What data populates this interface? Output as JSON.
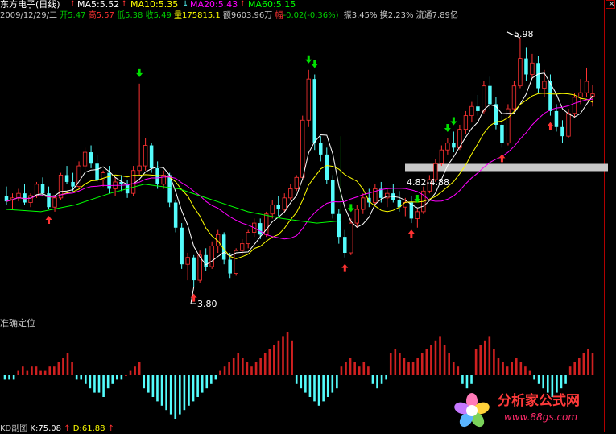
{
  "header": {
    "title": "东方电子(日线)",
    "ma5": "MA5:5.52",
    "ma10": "MA10:5.35",
    "ma20": "MA20:5.43",
    "ma60": "MA60:5.15"
  },
  "info": {
    "date": "2009/12/29/二",
    "open_label": "开",
    "open": "5.47",
    "high_label": "高",
    "high": "5.57",
    "low_label": "低",
    "low": "5.38",
    "close_label": "收",
    "close": "5.49",
    "vol_label": "量",
    "vol": "175815.1",
    "amt_label": "额",
    "amt": "9603.96万",
    "chg_label": "幅",
    "chg": "-0.02(-0.36%)",
    "amp_label": "振",
    "amp": "3.45%",
    "turn_label": "换",
    "turn": "2.23%",
    "float_label": "流通",
    "float": "7.89亿"
  },
  "annotations": {
    "high_mark": "5.98",
    "low_mark": "3.80",
    "zone_label": "4.82-4.88"
  },
  "sub_panel": {
    "title": "准确定位",
    "footer": "KD副图",
    "k": "K:75.08",
    "d": "D:61.88"
  },
  "watermark": {
    "name": "分析家公式网",
    "url": "www.88gs.com"
  },
  "colors": {
    "up": "#ff3232",
    "down": "#54fcfc",
    "ma5": "#ffffff",
    "ma10": "#ffff00",
    "ma20": "#ff00ff",
    "ma60": "#00ff00",
    "osc_pos": "#d02020",
    "osc_neg": "#54fcfc",
    "zone": "#c8c8c8",
    "buy_arrow": "#ff3232",
    "sell_arrow": "#00e000"
  },
  "chart_data": {
    "type": "candlestick",
    "title": "东方电子(日线)",
    "last_date": "2009/12/29",
    "price_range": [
      3.6,
      6.1
    ],
    "candles": [
      [
        4.6,
        4.68,
        4.52,
        4.55
      ],
      [
        4.56,
        4.62,
        4.48,
        4.58
      ],
      [
        4.58,
        4.66,
        4.55,
        4.62
      ],
      [
        4.62,
        4.7,
        4.52,
        4.54
      ],
      [
        4.54,
        4.62,
        4.5,
        4.6
      ],
      [
        4.6,
        4.72,
        4.58,
        4.7
      ],
      [
        4.7,
        4.76,
        4.6,
        4.62
      ],
      [
        4.62,
        4.68,
        4.48,
        4.5
      ],
      [
        4.5,
        4.6,
        4.46,
        4.58
      ],
      [
        4.58,
        4.8,
        4.56,
        4.78
      ],
      [
        4.78,
        4.86,
        4.7,
        4.72
      ],
      [
        4.72,
        4.8,
        4.64,
        4.68
      ],
      [
        4.68,
        4.9,
        4.66,
        4.86
      ],
      [
        4.86,
        5.02,
        4.82,
        4.98
      ],
      [
        4.98,
        5.04,
        4.84,
        4.88
      ],
      [
        4.88,
        4.96,
        4.72,
        4.74
      ],
      [
        4.74,
        4.82,
        4.68,
        4.8
      ],
      [
        4.8,
        4.86,
        4.62,
        4.66
      ],
      [
        4.66,
        4.76,
        4.6,
        4.72
      ],
      [
        4.72,
        4.78,
        4.64,
        4.7
      ],
      [
        4.7,
        4.74,
        4.58,
        4.62
      ],
      [
        4.62,
        4.86,
        4.6,
        4.82
      ],
      [
        4.82,
        5.58,
        4.78,
        4.86
      ],
      [
        4.86,
        5.1,
        4.82,
        5.04
      ],
      [
        5.04,
        5.06,
        4.8,
        4.84
      ],
      [
        4.84,
        4.9,
        4.66,
        4.7
      ],
      [
        4.7,
        4.82,
        4.66,
        4.78
      ],
      [
        4.78,
        4.8,
        4.5,
        4.54
      ],
      [
        4.54,
        4.56,
        4.28,
        4.32
      ],
      [
        4.32,
        4.36,
        3.96,
        4.0
      ],
      [
        4.0,
        4.1,
        3.86,
        4.06
      ],
      [
        4.06,
        4.08,
        3.8,
        3.86
      ],
      [
        3.86,
        4.12,
        3.84,
        4.08
      ],
      [
        4.08,
        4.14,
        3.94,
        3.98
      ],
      [
        3.98,
        4.2,
        3.96,
        4.16
      ],
      [
        4.16,
        4.3,
        4.1,
        4.26
      ],
      [
        4.26,
        4.28,
        4.0,
        4.04
      ],
      [
        4.04,
        4.1,
        3.88,
        3.92
      ],
      [
        3.92,
        4.14,
        3.9,
        4.12
      ],
      [
        4.12,
        4.22,
        4.08,
        4.18
      ],
      [
        4.18,
        4.3,
        4.14,
        4.28
      ],
      [
        4.28,
        4.4,
        4.24,
        4.36
      ],
      [
        4.36,
        4.4,
        4.22,
        4.26
      ],
      [
        4.26,
        4.46,
        4.24,
        4.44
      ],
      [
        4.44,
        4.56,
        4.4,
        4.52
      ],
      [
        4.52,
        4.6,
        4.42,
        4.48
      ],
      [
        4.48,
        4.62,
        4.46,
        4.58
      ],
      [
        4.58,
        4.7,
        4.56,
        4.66
      ],
      [
        4.66,
        4.78,
        4.64,
        4.76
      ],
      [
        4.76,
        5.3,
        4.74,
        5.26
      ],
      [
        5.26,
        5.7,
        5.2,
        5.62
      ],
      [
        5.62,
        5.66,
        5.0,
        5.06
      ],
      [
        5.06,
        5.12,
        4.9,
        4.96
      ],
      [
        4.96,
        5.02,
        4.7,
        4.74
      ],
      [
        4.74,
        4.78,
        4.4,
        4.44
      ],
      [
        4.44,
        4.48,
        4.18,
        4.24
      ],
      [
        4.24,
        4.3,
        4.06,
        4.1
      ],
      [
        4.1,
        4.4,
        4.08,
        4.36
      ],
      [
        4.36,
        4.52,
        4.32,
        4.48
      ],
      [
        4.48,
        4.62,
        4.44,
        4.58
      ],
      [
        4.58,
        4.66,
        4.5,
        4.54
      ],
      [
        4.54,
        4.7,
        4.52,
        4.66
      ],
      [
        4.66,
        4.72,
        4.54,
        4.58
      ],
      [
        4.58,
        4.66,
        4.5,
        4.62
      ],
      [
        4.62,
        4.7,
        4.54,
        4.56
      ],
      [
        4.56,
        4.64,
        4.46,
        4.5
      ],
      [
        4.5,
        4.58,
        4.42,
        4.54
      ],
      [
        4.54,
        4.6,
        4.36,
        4.4
      ],
      [
        4.4,
        4.48,
        4.32,
        4.46
      ],
      [
        4.46,
        4.68,
        4.44,
        4.64
      ],
      [
        4.64,
        4.78,
        4.62,
        4.74
      ],
      [
        4.74,
        4.92,
        4.72,
        4.88
      ],
      [
        4.88,
        5.04,
        4.86,
        5.0
      ],
      [
        5.0,
        5.1,
        4.96,
        5.06
      ],
      [
        5.06,
        5.16,
        4.98,
        5.02
      ],
      [
        5.02,
        5.22,
        5.0,
        5.18
      ],
      [
        5.18,
        5.34,
        5.14,
        5.3
      ],
      [
        5.3,
        5.42,
        5.24,
        5.38
      ],
      [
        5.38,
        5.48,
        5.3,
        5.34
      ],
      [
        5.34,
        5.6,
        5.32,
        5.56
      ],
      [
        5.56,
        5.64,
        5.36,
        5.4
      ],
      [
        5.4,
        5.46,
        5.18,
        5.22
      ],
      [
        5.22,
        5.3,
        5.02,
        5.06
      ],
      [
        5.06,
        5.4,
        5.04,
        5.36
      ],
      [
        5.36,
        5.6,
        5.34,
        5.56
      ],
      [
        5.56,
        5.98,
        5.54,
        5.8
      ],
      [
        5.8,
        5.9,
        5.6,
        5.66
      ],
      [
        5.66,
        5.84,
        5.62,
        5.76
      ],
      [
        5.76,
        5.82,
        5.5,
        5.54
      ],
      [
        5.54,
        5.7,
        5.46,
        5.6
      ],
      [
        5.6,
        5.66,
        5.3,
        5.34
      ],
      [
        5.34,
        5.4,
        5.16,
        5.2
      ],
      [
        5.2,
        5.26,
        5.06,
        5.12
      ],
      [
        5.12,
        5.36,
        5.1,
        5.32
      ],
      [
        5.32,
        5.5,
        5.28,
        5.46
      ],
      [
        5.46,
        5.62,
        5.4,
        5.5
      ],
      [
        5.5,
        5.72,
        5.46,
        5.6
      ],
      [
        5.47,
        5.57,
        5.38,
        5.49
      ]
    ],
    "ma60": [
      [
        0,
        4.48
      ],
      [
        10,
        4.46
      ],
      [
        20,
        4.52
      ],
      [
        30,
        4.62
      ],
      [
        40,
        4.7
      ],
      [
        50,
        4.66
      ],
      [
        60,
        4.56
      ],
      [
        70,
        4.46
      ],
      [
        80,
        4.4
      ],
      [
        90,
        4.36
      ],
      [
        100,
        4.38
      ],
      [
        110,
        4.42
      ],
      [
        120,
        4.5
      ],
      [
        130,
        4.6
      ],
      [
        140,
        4.72
      ],
      [
        150,
        4.85
      ],
      [
        160,
        5.0
      ],
      [
        170,
        5.12
      ]
    ],
    "osc": [
      -1,
      -1,
      -1,
      1,
      2,
      1,
      2,
      2,
      1,
      1,
      2,
      2,
      3,
      4,
      5,
      3,
      -1,
      -1,
      -2,
      -3,
      -4,
      -4,
      -5,
      -3,
      -2,
      -1,
      -1,
      0,
      1,
      2,
      3,
      -3,
      -4,
      -5,
      -6,
      -7,
      -8,
      -9,
      -10,
      -9,
      -8,
      -7,
      -6,
      -5,
      -4,
      -3,
      -2,
      -1,
      1,
      2,
      3,
      4,
      5,
      4,
      3,
      2,
      3,
      4,
      5,
      6,
      7,
      8,
      9,
      10,
      8,
      -2,
      -3,
      -4,
      -5,
      -6,
      -7,
      -6,
      -5,
      -4,
      -3,
      2,
      3,
      4,
      3,
      2,
      3,
      2,
      -2,
      -3,
      -2,
      -1,
      5,
      6,
      5,
      4,
      3,
      3,
      4,
      5,
      6,
      7,
      8,
      9,
      7,
      5,
      3,
      2,
      -2,
      -3,
      -2,
      6,
      7,
      8,
      9,
      6,
      4,
      3,
      2,
      3,
      4,
      3,
      2,
      1,
      -1,
      -2,
      -3,
      -4,
      -5,
      -4,
      -3,
      -2,
      2,
      3,
      4,
      5,
      6,
      5
    ]
  }
}
